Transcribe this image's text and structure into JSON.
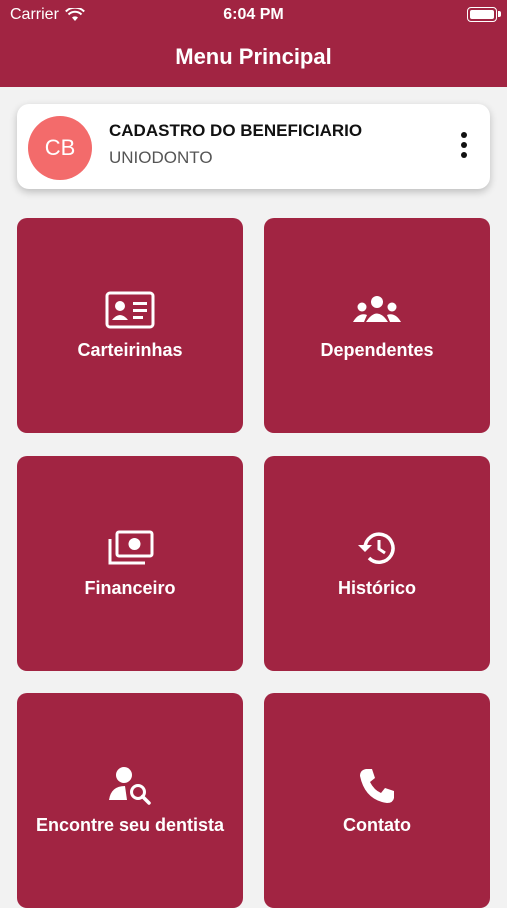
{
  "status_bar": {
    "carrier": "Carrier",
    "time": "6:04 PM"
  },
  "header": {
    "title": "Menu Principal"
  },
  "profile_card": {
    "initials": "CB",
    "title": "CADASTRO DO BENEFICIARIO",
    "subtitle": "UNIODONTO"
  },
  "menu": {
    "carteirinhas": "Carteirinhas",
    "dependentes": "Dependentes",
    "financeiro": "Financeiro",
    "historico": "Histórico",
    "dentista": "Encontre seu dentista",
    "contato": "Contato"
  },
  "colors": {
    "brand": "#a12442",
    "avatar": "#f36b6b",
    "background": "#f2f2f2"
  }
}
